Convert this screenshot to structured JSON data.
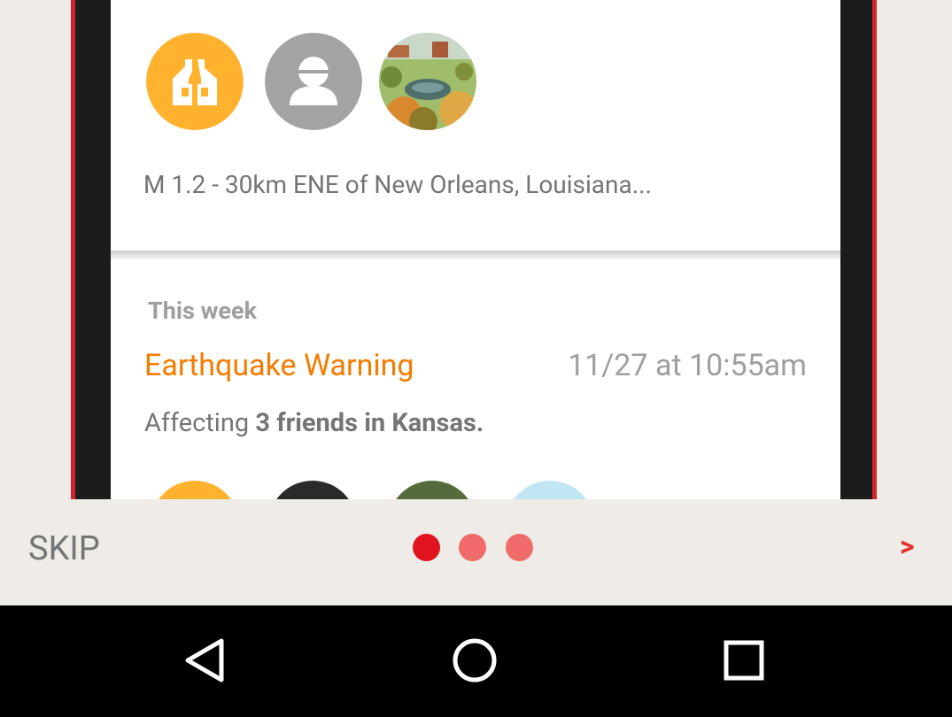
{
  "card": {
    "event_line": "M 1.2 - 30km ENE of New Orleans, Louisiana...",
    "icons": [
      "house-damage-icon",
      "person-icon",
      "landscape-photo"
    ]
  },
  "alert": {
    "section_title": "This week",
    "warning_title": "Earthquake Warning",
    "warning_time": "11/27 at 10:55am",
    "affecting_prefix": "Affecting ",
    "affecting_bold": "3 friends in Kansas."
  },
  "onboarding": {
    "skip_label": "SKIP",
    "next_label": ">",
    "page_count": 3,
    "current_page": 1,
    "active_dot_color": "#e0141e",
    "inactive_dot_color": "#f26b6b"
  },
  "nav": {
    "back": "back-icon",
    "home": "home-icon",
    "recents": "recents-icon"
  },
  "colors": {
    "accent": "#e5302b",
    "warning": "#f57c00",
    "avatar_orange": "#ffb22e",
    "avatar_gray": "#a3a3a3"
  }
}
